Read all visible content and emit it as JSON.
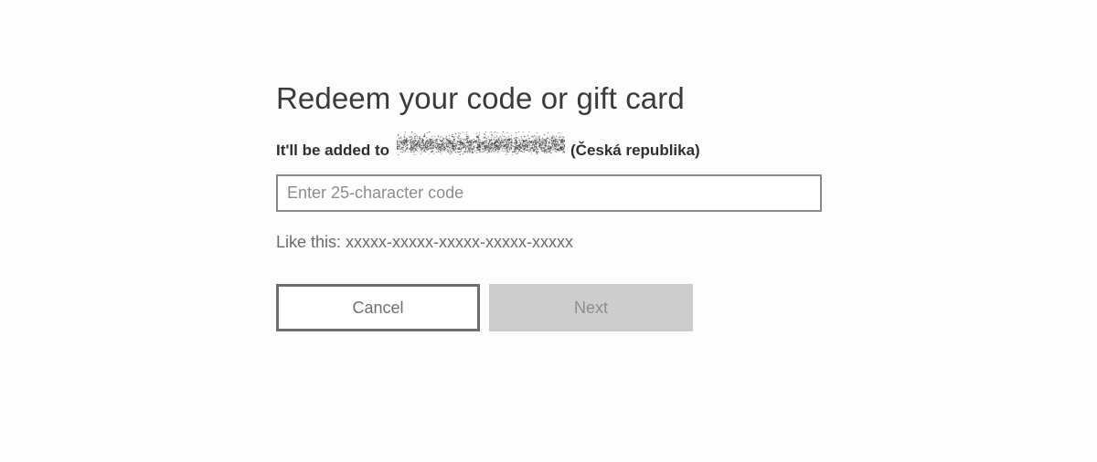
{
  "dialog": {
    "title": "Redeem your code or gift card",
    "subtitle_prefix": "It'll be added to",
    "account_redacted": true,
    "region": "(Česká republika)",
    "code_input": {
      "value": "",
      "placeholder": "Enter 25-character code"
    },
    "hint": "Like this: xxxxx-xxxxx-xxxxx-xxxxx-xxxxx",
    "buttons": {
      "cancel_label": "Cancel",
      "next_label": "Next",
      "next_disabled": true
    }
  },
  "colors": {
    "page_background": "#fdfdfd",
    "title_text": "#3b3b3b",
    "subtitle_text": "#2f2f2f",
    "hint_text": "#6b6b6b",
    "input_border": "#8a8a8a",
    "placeholder_text": "#8c8c8c",
    "cancel_border": "#6e6e6e",
    "cancel_text": "#6f6f6f",
    "next_background": "#cdcdcd",
    "next_text": "#8d8d8d"
  }
}
